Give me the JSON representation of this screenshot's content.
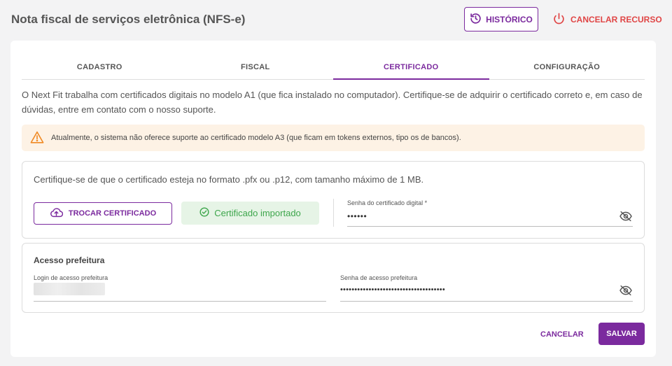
{
  "header": {
    "title": "Nota fiscal de serviços eletrônica (NFS-e)",
    "history_label": "HISTÓRICO",
    "cancel_resource_label": "CANCELAR RECURSO"
  },
  "tabs": [
    {
      "label": "CADASTRO",
      "active": false
    },
    {
      "label": "FISCAL",
      "active": false
    },
    {
      "label": "CERTIFICADO",
      "active": true
    },
    {
      "label": "CONFIGURAÇÃO",
      "active": false
    }
  ],
  "intro_text": "O Next Fit trabalha com certificados digitais no modelo A1 (que fica instalado no computador). Certifique-se de adquirir o certificado correto e, em caso de dúvidas, entre em contato com o nosso suporte.",
  "alert": {
    "icon": "warning-icon",
    "text": "Atualmente, o sistema não oferece suporte ao certificado modelo A3 (que ficam em tokens externos, tipo os de bancos)."
  },
  "certificate": {
    "hint": "Certifique-se de que o certificado esteja no formato .pfx ou .p12, com tamanho máximo de 1 MB.",
    "swap_button": "TROCAR CERTIFICADO",
    "status": "Certificado importado",
    "password_label": "Senha do certificado digital *",
    "password_value": "••••••"
  },
  "prefeitura": {
    "title": "Acesso prefeitura",
    "login_label": "Login de acesso prefeitura",
    "login_value": "",
    "password_label": "Senha de acesso prefeitura",
    "password_value": "•••••••••••••••••••••••••••••••••••••"
  },
  "footer": {
    "cancel_label": "CANCELAR",
    "save_label": "SALVAR"
  },
  "colors": {
    "primary": "#7b2a9e",
    "danger": "#e04545",
    "success": "#3ea64c",
    "warning": "#f08a24"
  }
}
